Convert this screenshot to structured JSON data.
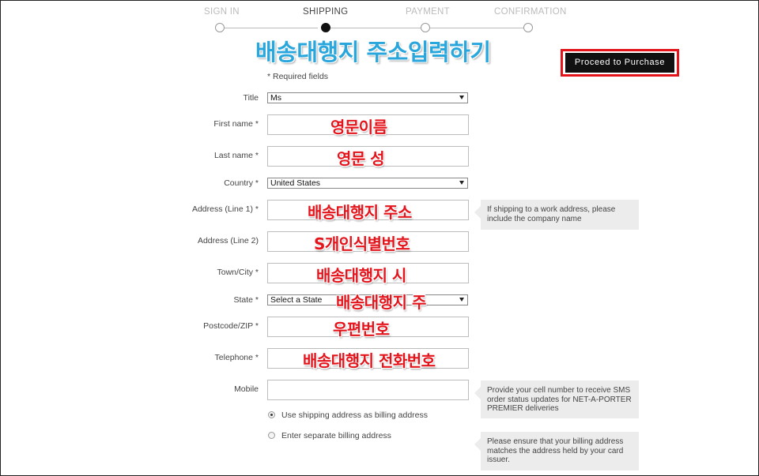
{
  "steps": [
    {
      "label": "SIGN IN",
      "active": false
    },
    {
      "label": "SHIPPING",
      "active": true
    },
    {
      "label": "PAYMENT",
      "active": false
    },
    {
      "label": "CONFIRMATION",
      "active": false
    }
  ],
  "heading": "배송대행지 주소입력하기",
  "proceed_button": "Proceed to Purchase",
  "required_note": "* Required fields",
  "form": {
    "title": {
      "label": "Title",
      "value": "Ms"
    },
    "first_name": {
      "label": "First name *",
      "annotation": "영문이름"
    },
    "last_name": {
      "label": "Last name *",
      "annotation": "영문 성"
    },
    "country": {
      "label": "Country *",
      "value": "United States"
    },
    "address1": {
      "label": "Address (Line 1) *",
      "annotation": "배송대행지 주소"
    },
    "address2": {
      "label": "Address (Line 2)",
      "annotation": "S개인식별번호"
    },
    "town": {
      "label": "Town/City *",
      "annotation": "배송대행지 시"
    },
    "state": {
      "label": "State *",
      "value": "Select a State",
      "annotation": "배송대행지 주"
    },
    "postcode": {
      "label": "Postcode/ZIP *",
      "annotation": "우편번호"
    },
    "telephone": {
      "label": "Telephone *",
      "annotation": "배송대행지 전화번호"
    },
    "mobile": {
      "label": "Mobile"
    }
  },
  "hints": {
    "address": "If shipping to a work address, please include the company name",
    "mobile": "Provide your cell number to receive SMS order status updates for NET-A-PORTER PREMIER deliveries",
    "billing": "Please ensure that your billing address matches the address held by your card issuer."
  },
  "billing_options": [
    {
      "label": "Use shipping address as billing address",
      "checked": true
    },
    {
      "label": "Enter separate billing address",
      "checked": false
    }
  ],
  "colors": {
    "heading": "#29a6db",
    "annotation": "#e3141b",
    "highlight_border": "#e4141b",
    "button_bg": "#111111"
  }
}
